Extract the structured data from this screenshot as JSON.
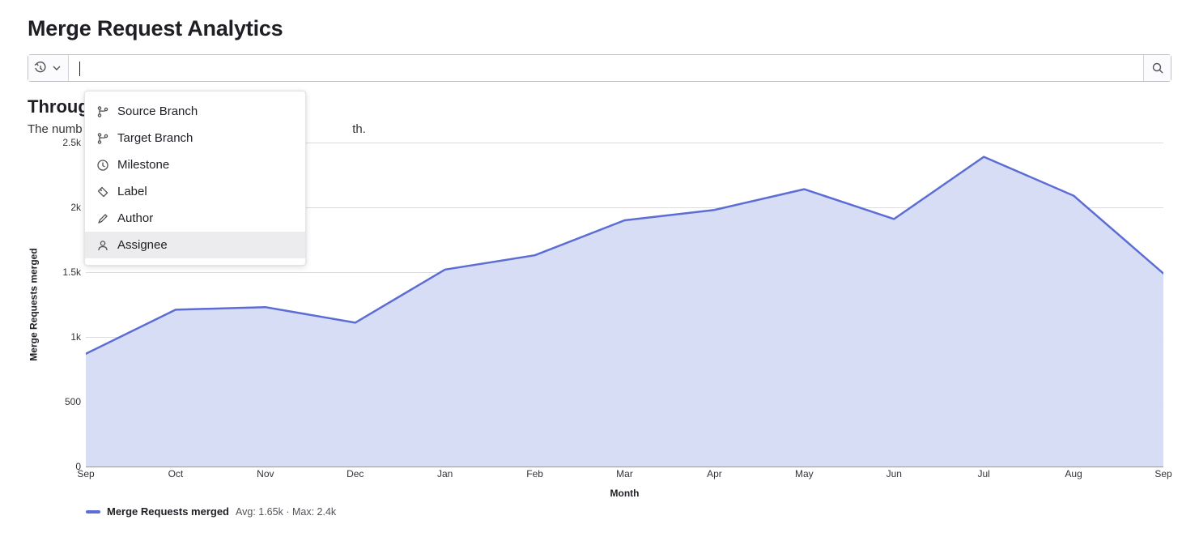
{
  "header": {
    "page_title": "Merge Request Analytics",
    "sub_title": "Throughput",
    "sub_desc_prefix": "The numb",
    "sub_desc_suffix": "th."
  },
  "filter": {
    "placeholder": "",
    "value": "",
    "options": [
      {
        "icon": "branch-icon",
        "label": "Source Branch"
      },
      {
        "icon": "branch-icon",
        "label": "Target Branch"
      },
      {
        "icon": "clock-icon",
        "label": "Milestone"
      },
      {
        "icon": "tag-icon",
        "label": "Label"
      },
      {
        "icon": "pencil-icon",
        "label": "Author"
      },
      {
        "icon": "user-icon",
        "label": "Assignee"
      }
    ],
    "hovered_index": 5
  },
  "chart_data": {
    "type": "area",
    "title": "",
    "xlabel": "Month",
    "ylabel": "Merge Requests merged",
    "ylim": [
      0,
      2500
    ],
    "y_ticks": [
      0,
      500,
      1000,
      1500,
      2000,
      2500
    ],
    "y_tick_labels": [
      "0",
      "500",
      "1k",
      "1.5k",
      "2k",
      "2.5k"
    ],
    "categories": [
      "Sep",
      "Oct",
      "Nov",
      "Dec",
      "Jan",
      "Feb",
      "Mar",
      "Apr",
      "May",
      "Jun",
      "Jul",
      "Aug",
      "Sep"
    ],
    "series": [
      {
        "name": "Merge Requests merged",
        "values": [
          870,
          1210,
          1230,
          1110,
          1520,
          1630,
          1900,
          1980,
          2140,
          1910,
          2390,
          2090,
          1490
        ]
      }
    ],
    "legend": {
      "name": "Merge Requests merged",
      "avg_label": "Avg: 1.65k",
      "sep": " · ",
      "max_label": "Max: 2.4k"
    },
    "colors": {
      "line": "#5c6dd3",
      "area": "#d6dbf5",
      "grid": "#dcdcde",
      "axis": "#999a9e"
    }
  }
}
